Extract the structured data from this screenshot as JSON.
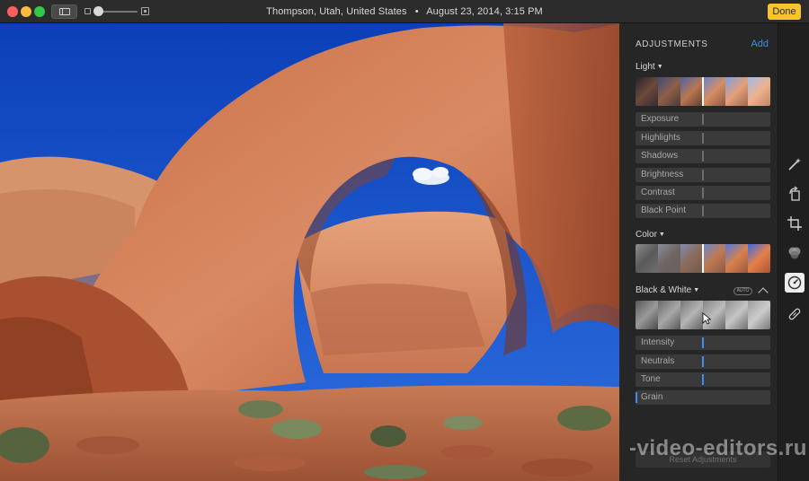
{
  "window": {
    "title": "Thompson, Utah, United States",
    "datetime": "August 23, 2014, 3:15 PM",
    "title_separator": "•",
    "done_label": "Done"
  },
  "toolbar": {
    "icons": [
      "sidebar-icon",
      "zoom-out-icon",
      "zoom-slider",
      "zoom-in-icon"
    ]
  },
  "adjustments": {
    "title": "ADJUSTMENTS",
    "add_label": "Add",
    "light": {
      "title": "Light",
      "sliders": [
        {
          "label": "Exposure"
        },
        {
          "label": "Highlights"
        },
        {
          "label": "Shadows"
        },
        {
          "label": "Brightness"
        },
        {
          "label": "Contrast"
        },
        {
          "label": "Black Point"
        }
      ]
    },
    "color": {
      "title": "Color"
    },
    "black_white": {
      "title": "Black & White",
      "auto_label": "AUTO",
      "sliders": [
        {
          "label": "Intensity"
        },
        {
          "label": "Neutrals"
        },
        {
          "label": "Tone"
        },
        {
          "label": "Grain"
        }
      ]
    },
    "reset_label": "Reset Adjustments"
  },
  "tools": [
    "magic-wand-icon",
    "rotate-icon",
    "crop-icon",
    "filters-icon",
    "adjust-icon",
    "retouch-icon"
  ],
  "watermark": "-video-editors.ru",
  "colors": {
    "accent": "#3b8cf4",
    "done": "#f6c42d",
    "panel": "#262626"
  }
}
